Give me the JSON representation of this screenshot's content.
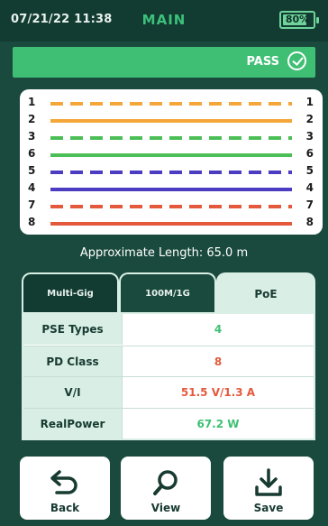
{
  "status": {
    "time": "07/21/22 11:38",
    "title": "MAIN",
    "battery_label": "80%",
    "battery_level": 0.8
  },
  "result": {
    "label": "PASS"
  },
  "wiremap": {
    "rows": [
      {
        "left": "1",
        "right": "1",
        "color": "#f4a63a",
        "style": "dashed"
      },
      {
        "left": "2",
        "right": "2",
        "color": "#f4a63a",
        "style": "solid"
      },
      {
        "left": "3",
        "right": "3",
        "color": "#4bbf56",
        "style": "dashed"
      },
      {
        "left": "6",
        "right": "6",
        "color": "#4bbf56",
        "style": "solid"
      },
      {
        "left": "5",
        "right": "5",
        "color": "#4b3cc2",
        "style": "dashed"
      },
      {
        "left": "4",
        "right": "4",
        "color": "#4b3cc2",
        "style": "solid"
      },
      {
        "left": "7",
        "right": "7",
        "color": "#e4593c",
        "style": "dashed"
      },
      {
        "left": "8",
        "right": "8",
        "color": "#e4593c",
        "style": "solid"
      }
    ]
  },
  "approx_length": "Approximate Length: 65.0 m",
  "tabs": [
    {
      "label": "Multi-Gig"
    },
    {
      "label": "100M/1G"
    },
    {
      "label": "PoE"
    }
  ],
  "poe_table": [
    {
      "label": "PSE Types",
      "value": "4",
      "color": "#3fbf74"
    },
    {
      "label": "PD Class",
      "value": "8",
      "color": "#e4593c"
    },
    {
      "label": "V/I",
      "value": "51.5 V/1.3 A",
      "color": "#e4593c"
    },
    {
      "label": "RealPower",
      "value": "67.2 W",
      "color": "#3fbf74"
    }
  ],
  "buttons": [
    {
      "label": "Back",
      "icon": "back-arrow-icon"
    },
    {
      "label": "View",
      "icon": "search-icon"
    },
    {
      "label": "Save",
      "icon": "download-icon"
    }
  ]
}
